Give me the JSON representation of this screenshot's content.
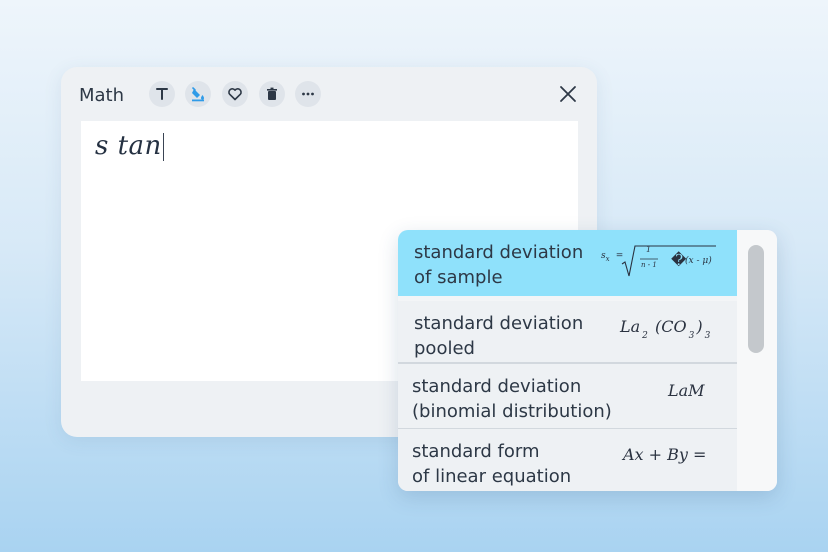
{
  "panel": {
    "title": "Math",
    "tools": [
      {
        "name": "text-format-icon"
      },
      {
        "name": "fill-color-icon"
      },
      {
        "name": "heart-icon"
      },
      {
        "name": "trash-icon"
      },
      {
        "name": "more-options-icon"
      }
    ],
    "close_icon": "close-icon"
  },
  "editor": {
    "value": "s tan "
  },
  "suggestions": [
    {
      "line1": "standard deviation",
      "line2": "of sample",
      "formula": {
        "s": "s",
        "s_sub": "x",
        "eq": "=",
        "num": "1",
        "den": "n - 1",
        "glyph": "�",
        "paren": "(x - μ)"
      },
      "selected": true
    },
    {
      "line1": "standard deviation",
      "line2": "pooled",
      "formula": {
        "base": "La",
        "sub1": "2",
        "mid": "(CO",
        "sub2": "3",
        "close": ")",
        "sub3": "3"
      },
      "selected": false
    },
    {
      "line1": "standard deviation",
      "line2": "(binomial distribution)",
      "formula": {
        "text": "LaM"
      },
      "selected": false
    },
    {
      "line1": "standard form",
      "line2": "of linear equation",
      "formula": {
        "text": "Ax + By ="
      },
      "selected": false
    }
  ],
  "colors": {
    "selected_item": "#8fe1fb",
    "fill_icon_accent": "#2f9be8"
  }
}
